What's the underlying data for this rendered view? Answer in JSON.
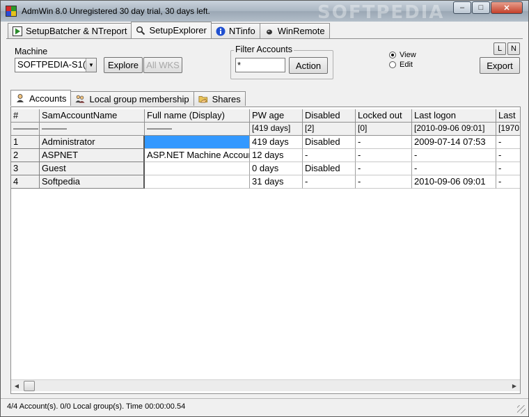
{
  "window": {
    "title": "AdmWin 8.0 Unregistered 30 day trial, 30 days left.",
    "brand_watermark": "SOFTPEDIA",
    "controls": {
      "minimize": "–",
      "maximize": "□",
      "close": "✕"
    }
  },
  "main_tabs": [
    {
      "label": "SetupBatcher & NTreport",
      "icon": "play-icon",
      "active": false
    },
    {
      "label": "SetupExplorer",
      "icon": "magnifier-icon",
      "active": true
    },
    {
      "label": "NTinfo",
      "icon": "info-icon",
      "active": false
    },
    {
      "label": "WinRemote",
      "icon": "remote-icon",
      "active": false
    }
  ],
  "toolbar": {
    "machine_label": "Machine",
    "machine_value": "SOFTPEDIA-S1(",
    "explore_label": "Explore",
    "all_wks_label": "All WKS",
    "filter_label": "Filter Accounts",
    "filter_value": "*",
    "action_label": "Action",
    "view_label": "View",
    "edit_label": "Edit",
    "l_label": "L",
    "n_label": "N",
    "export_label": "Export"
  },
  "sub_tabs": [
    {
      "label": "Accounts",
      "icon": "user-icon",
      "active": true
    },
    {
      "label": "Local group membership",
      "icon": "users-icon",
      "active": false
    },
    {
      "label": "Shares",
      "icon": "folder-share-icon",
      "active": false
    }
  ],
  "grid": {
    "columns": [
      "#",
      "SamAccountName",
      "Full name (Display)",
      "PW age",
      "Disabled",
      "Locked out",
      "Last logon",
      "Last"
    ],
    "filters": [
      "———",
      "———",
      "———",
      "[419 days]",
      "[2]",
      "[0]",
      "[2010-09-06 09:01]",
      "[1970"
    ],
    "rows": [
      [
        "1",
        "Administrator",
        "",
        "419 days",
        "Disabled",
        "-",
        "2009-07-14 07:53",
        "-"
      ],
      [
        "2",
        "ASPNET",
        "ASP.NET Machine Account",
        "12 days",
        "-",
        "-",
        "-",
        "-"
      ],
      [
        "3",
        "Guest",
        "",
        "0 days",
        "Disabled",
        "-",
        "-",
        "-"
      ],
      [
        "4",
        "Softpedia",
        "",
        "31 days",
        "-",
        "-",
        "2010-09-06 09:01",
        "-"
      ]
    ],
    "selected_cell": {
      "row": 0,
      "col": 2
    }
  },
  "status_bar": {
    "text": "4/4 Account(s). 0/0 Local group(s).  Time 00:00:00.54"
  },
  "colors": {
    "selection": "#3399ff",
    "titlebar": "#aab6c2"
  }
}
